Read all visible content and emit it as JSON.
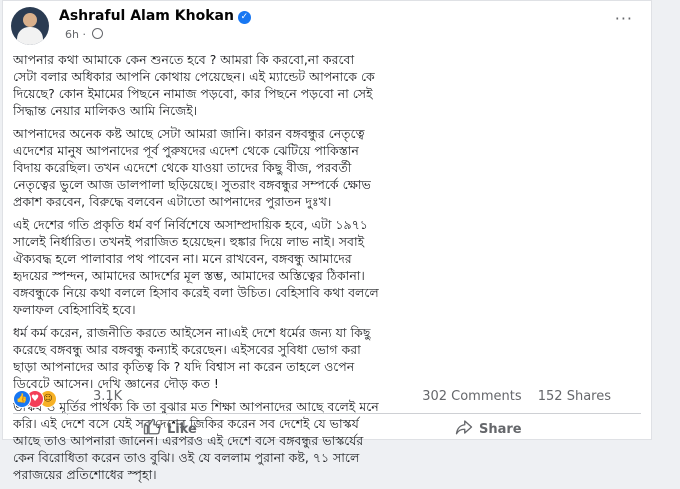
{
  "post": {
    "author": "Ashraful Alam Khokan",
    "time": "6h",
    "paragraphs": [
      [
        "আপনার কথা আমাকে কেন শুনতে হবে ? আমরা কি করবো,না করবো",
        "সেটা বলার অধিকার আপনি কোথায় পেয়েছেন। এই ম্যান্ডেট আপনাকে কে",
        "দিয়েছে? কোন ইমামের পিছনে নামাজ পড়বো, কার পিছনে পড়বো না সেই",
        "সিদ্ধান্ত নেয়ার মালিকও আমি নিজেই।"
      ],
      [
        "আপনাদের অনেক কষ্ট আছে সেটা আমরা জানি। কারন বঙ্গবন্ধুর নেতৃত্বে",
        "এদেশের মানুষ আপনাদের পূর্ব পুরুষদের এদেশ থেকে ঝেটিয়ে পাকিস্তান",
        "বিদায় করেছিল। তখন এদেশে থেকে যাওয়া তাদের কিছু বীজ, পরবর্তী",
        "নেতৃত্বের ভুলে আজ ডালপালা ছড়িয়েছে। সুতরাং বঙ্গবন্ধুর সম্পর্কে ক্ষোভ",
        "প্রকাশ করবেন, বিরুদ্ধে বলবেন এটাতো আপনাদের পুরাতন দুঃখ।"
      ],
      [
        "এই দেশের গতি প্রকৃতি ধর্ম বর্ণ নির্বিশেষে অসাম্প্রদায়িক হবে, এটা ১৯৭১",
        "সালেই নির্ধারিত। তখনই পরাজিত হয়েছেন। হুঙ্কার দিয়ে লাভ নাই। সবাই",
        "ঐক্যবদ্ধ হলে পালাবার পথ পাবেন না। মনে রাখবেন, বঙ্গবন্ধু আমাদের",
        "হৃদয়ের স্পন্দন, আমাদের আদর্শের মূল স্তম্ভ, আমাদের অস্তিত্বের ঠিকানা।",
        "বঙ্গবন্ধুকে নিয়ে কথা বললে হিসাব করেই বলা উচিত। বেহিসাবি কথা বললে",
        "ফলাফল বেহিসাবিই হবে।"
      ],
      [
        "ধর্ম কর্ম করেন, রাজনীতি করতে আইসেন না।এই দেশে ধর্মের জন্য যা কিছু",
        "করেছে বঙ্গবন্ধু আর বঙ্গবন্ধু কন্যাই করেছেন। এইসবের সুবিধা ভোগ করা",
        "ছাড়া আপনাদের আর কৃতিত্ব কি ? যদি বিশ্বাস না করেন তাহলে ওপেন",
        "ডিবেটে আসেন। দেখি জ্ঞানের দৌড় কত !"
      ],
      [
        "ভাস্কর্য ও মূর্তির পার্থক্য কি তা বুঝার মত শিক্ষা আপনাদের আছে বলেই মনে",
        "করি। এই দেশে বসে যেই সব দেশের জিকির করেন সব দেশেই যে ভাস্কর্য",
        "আছে তাও আপনারা জানেন। এরপরও এই দেশে বসে বঙ্গবন্ধুর ভাস্কর্যের",
        "কেন বিরোধিতা করেন তাও বুঝি। ওই যে বললাম পুরানা কষ্ট, ৭১ সালে",
        "পরাজয়ের প্রতিশোধের স্পৃহা।"
      ]
    ]
  },
  "engagement": {
    "reactions_count": "3.1K",
    "comments": "302 Comments",
    "shares": "152 Shares",
    "reaction_icons": [
      "like-icon",
      "love-icon",
      "haha-icon"
    ]
  },
  "actions": {
    "like_label": "Like",
    "share_label": "Share"
  },
  "colors": {
    "accent": "#1877f2",
    "love": "#f33e58",
    "haha": "#f7b125",
    "muted_text": "#65676b"
  }
}
